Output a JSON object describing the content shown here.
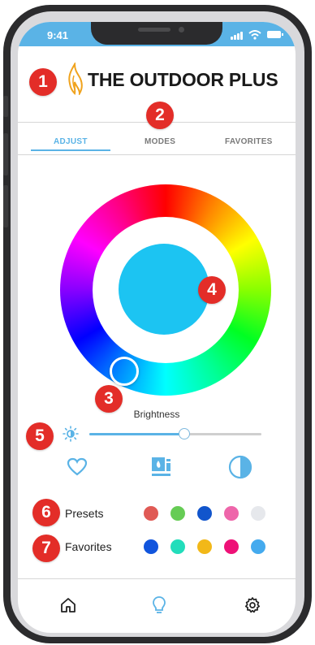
{
  "status_bar": {
    "time": "9:41"
  },
  "brand": {
    "name": "THE OUTDOOR PLUS",
    "logo_icon": "flame-logo-icon"
  },
  "tabs": [
    {
      "label": "ADJUST",
      "active": true
    },
    {
      "label": "MODES",
      "active": false
    },
    {
      "label": "FAVORITES",
      "active": false
    }
  ],
  "callouts": [
    "1",
    "2",
    "3",
    "4",
    "5",
    "6",
    "7"
  ],
  "color_wheel": {
    "selected_color": "#1cc4f2"
  },
  "brightness": {
    "label": "Brightness",
    "value_fraction": 0.55
  },
  "actions": [
    {
      "icon": "heart-icon"
    },
    {
      "icon": "scene-icon"
    },
    {
      "icon": "contrast-icon"
    }
  ],
  "presets": {
    "label": "Presets",
    "colors": [
      "#e05a55",
      "#66cc55",
      "#1155cc",
      "#ee66aa",
      "#e6e8ec"
    ]
  },
  "favorites": {
    "label": "Favorites",
    "colors": [
      "#1155dd",
      "#22ddbb",
      "#f2b818",
      "#ee1177",
      "#44aaee"
    ]
  },
  "bottom_nav": [
    {
      "icon": "home-icon",
      "active": false
    },
    {
      "icon": "bulb-icon",
      "active": true
    },
    {
      "icon": "gear-icon",
      "active": false
    }
  ],
  "colors": {
    "accent": "#5ab3e6",
    "callout": "#e32d28"
  }
}
